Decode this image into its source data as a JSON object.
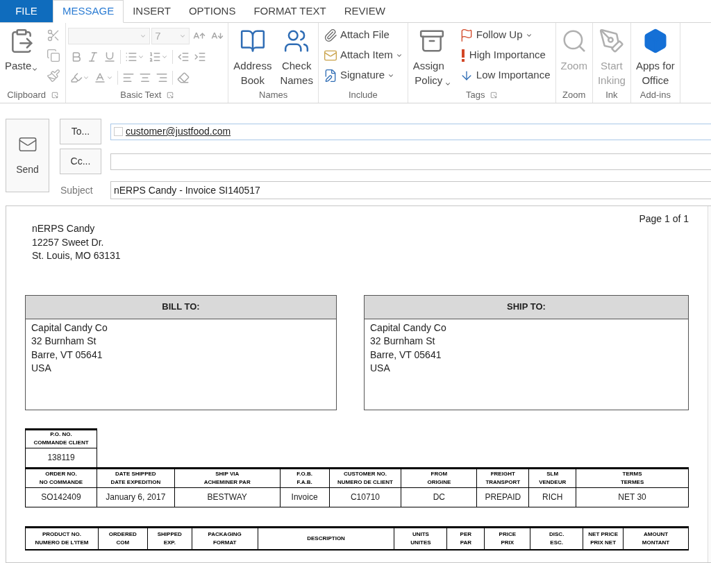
{
  "tabs": [
    {
      "label": "FILE",
      "kind": "file",
      "selected": false
    },
    {
      "label": "MESSAGE",
      "kind": "tab",
      "selected": true
    },
    {
      "label": "INSERT",
      "kind": "tab",
      "selected": false
    },
    {
      "label": "OPTIONS",
      "kind": "tab",
      "selected": false
    },
    {
      "label": "FORMAT TEXT",
      "kind": "tab",
      "selected": false
    },
    {
      "label": "REVIEW",
      "kind": "tab",
      "selected": false
    }
  ],
  "ribbon": [
    {
      "label": "Clipboard",
      "kind": "buttons",
      "launcher": true,
      "buttons": [
        {
          "kind": "large",
          "label": "Paste",
          "dropdown": true,
          "disabled": false
        },
        {
          "kind": "tool",
          "disabled": true
        },
        {
          "kind": "tool",
          "disabled": true
        },
        {
          "kind": "tool",
          "disabled": true
        }
      ]
    },
    {
      "label": "Basic Text",
      "kind": "format",
      "launcher": true,
      "disabled": true,
      "size_field": {
        "value": "7"
      }
    },
    {
      "label": "Names",
      "kind": "buttons",
      "buttons": [
        {
          "kind": "large",
          "label": "Address\nBook",
          "disabled": false
        },
        {
          "kind": "large",
          "label": "Check\nNames",
          "disabled": false
        }
      ]
    },
    {
      "label": "Include",
      "kind": "buttons",
      "buttons": [
        {
          "kind": "small",
          "label": "Attach File",
          "disabled": false
        },
        {
          "kind": "small",
          "label": "Attach Item",
          "dropdown": true,
          "disabled": false
        },
        {
          "kind": "small",
          "label": "Signature",
          "dropdown": true,
          "disabled": false
        }
      ]
    },
    {
      "label": "Tags",
      "kind": "buttons",
      "launcher": true,
      "buttons": [
        {
          "kind": "large",
          "label": "Assign\nPolicy",
          "dropdown": true,
          "disabled": false
        },
        {
          "kind": "small",
          "label": "Follow Up",
          "dropdown": true,
          "disabled": false
        },
        {
          "kind": "small",
          "label": "High Importance",
          "disabled": false
        },
        {
          "kind": "small",
          "label": "Low Importance",
          "disabled": false
        }
      ]
    },
    {
      "label": "Zoom",
      "kind": "buttons",
      "buttons": [
        {
          "kind": "large",
          "label": "Zoom",
          "disabled": true
        }
      ]
    },
    {
      "label": "Ink",
      "kind": "buttons",
      "buttons": [
        {
          "kind": "large",
          "label": "Start\nInking",
          "disabled": true
        }
      ]
    },
    {
      "label": "Add-ins",
      "kind": "buttons",
      "buttons": [
        {
          "kind": "large",
          "label": "Apps for\nOffice",
          "disabled": false
        }
      ]
    }
  ],
  "compose": {
    "send_button": "Send",
    "to_button": "To...",
    "cc_button": "Cc...",
    "subject_label": "Subject",
    "to": {
      "value": "customer@justfood.com"
    },
    "subject": {
      "value": "nERPS Candy - Invoice SI140517"
    }
  },
  "document": {
    "page_number": "Page 1 of 1",
    "sender": [
      "nERPS Candy",
      "12257 Sweet Dr.",
      "St. Louis, MO  63131"
    ],
    "addresses": [
      {
        "title": "BILL TO:",
        "lines": [
          "Capital Candy Co",
          "32 Burnham St",
          "Barre, VT  05641",
          "USA"
        ]
      },
      {
        "title": "SHIP TO:",
        "lines": [
          "Capital Candy Co",
          "32 Burnham St",
          "Barre, VT  05641",
          "USA"
        ]
      }
    ],
    "po": {
      "header": "P.O. NO.\nCOMMANDE CLIENT",
      "value": "138119"
    },
    "order_columns": [
      {
        "header": "ORDER NO.\nNO COMMANDE",
        "value": "SO142409"
      },
      {
        "header": "DATE SHIPPED\nDATE EXPEDITION",
        "value": "January 6, 2017"
      },
      {
        "header": "SHIP VIA\nACHEMINER PAR",
        "value": "BESTWAY"
      },
      {
        "header": "F.O.B.\nF.A.B.",
        "value": "Invoice"
      },
      {
        "header": "CUSTOMER NO.\nNUMERO DE CLIENT",
        "value": "C10710"
      },
      {
        "header": "FROM\nORIGINE",
        "value": "DC"
      },
      {
        "header": "FREIGHT\nTRANSPORT",
        "value": "PREPAID"
      },
      {
        "header": "SLM\nVENDEUR",
        "value": "RICH"
      },
      {
        "header": "TERMS\nTERMES",
        "value": "NET 30"
      }
    ],
    "item_columns": [
      "PRODUCT NO.\nNUMERO DE L'ITEM",
      "ORDERED\nCOM",
      "SHIPPED\nEXP.",
      "PACKAGING\nFORMAT",
      "DESCRIPTION",
      "UNITS\nUNITES",
      "PER\nPAR",
      "PRICE\nPRIX",
      "DISC.\nESC.",
      "NET PRICE\nPRIX NET",
      "AMOUNT\nMONTANT"
    ]
  }
}
